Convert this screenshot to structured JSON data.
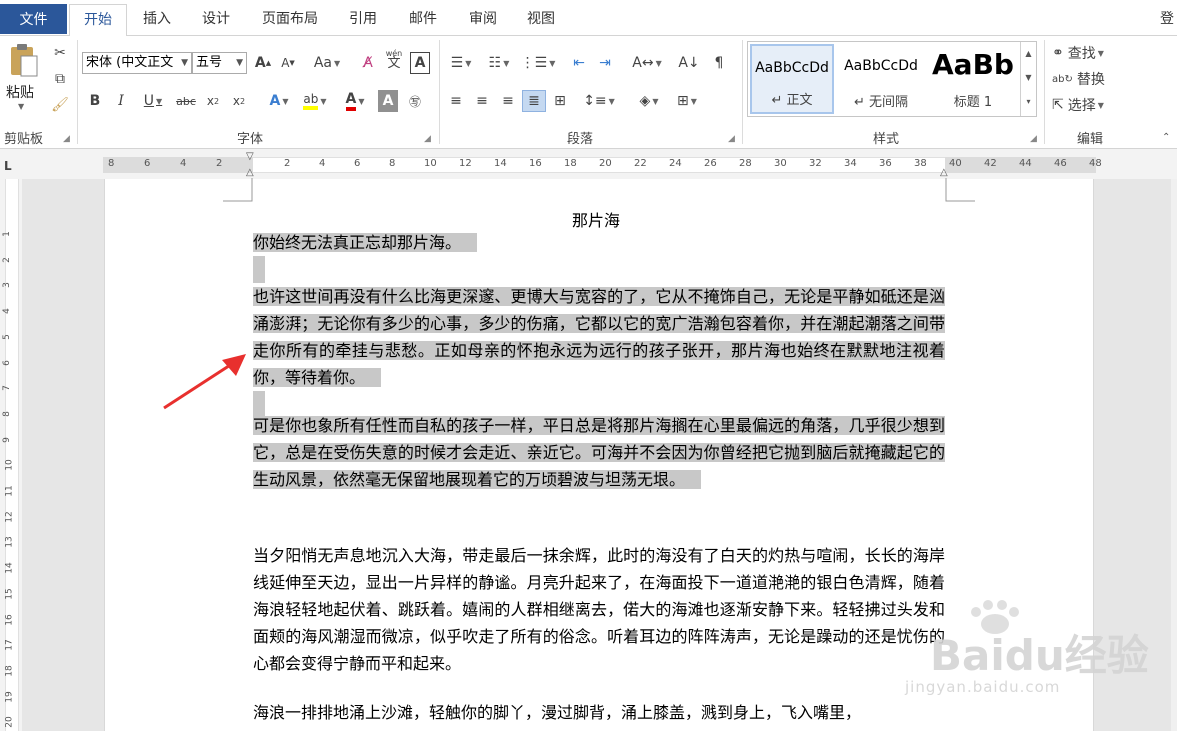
{
  "tabs": {
    "file": "文件",
    "items": [
      "开始",
      "插入",
      "设计",
      "页面布局",
      "引用",
      "邮件",
      "审阅",
      "视图"
    ],
    "login": "登"
  },
  "clipboard": {
    "paste": "粘贴",
    "group": "剪贴板"
  },
  "font": {
    "name": "宋体 (中文正文",
    "size": "五号",
    "group": "字体",
    "change_case": "Aa",
    "phonetic_top": "wén",
    "phonetic_bottom": "文",
    "border_char": "A"
  },
  "paragraph": {
    "group": "段落"
  },
  "styles": {
    "group": "样式",
    "items": [
      {
        "sample": "AaBbCcDd",
        "name": "↵ 正文"
      },
      {
        "sample": "AaBbCcDd",
        "name": "↵ 无间隔"
      },
      {
        "sample": "AaBb",
        "name": "标题 1"
      }
    ]
  },
  "editing": {
    "find": "查找",
    "replace": "替换",
    "select": "选择",
    "group": "编辑"
  },
  "ruler": {
    "corner": "L",
    "left_numbers": [
      "8",
      "6",
      "4",
      "2"
    ],
    "right_numbers": [
      "2",
      "4",
      "6",
      "8",
      "10",
      "12",
      "14",
      "16",
      "18",
      "20",
      "22",
      "24",
      "26",
      "28",
      "30",
      "32",
      "34",
      "36",
      "38",
      "40",
      "42",
      "44",
      "46",
      "48"
    ],
    "vertical_numbers": [
      "1",
      "2",
      "3",
      "4",
      "5",
      "6",
      "7",
      "8",
      "9",
      "10",
      "11",
      "12",
      "13",
      "14",
      "15",
      "16",
      "17",
      "18",
      "19",
      "20"
    ]
  },
  "document": {
    "title": "那片海",
    "p1": "你始终无法真正忘却那片海。",
    "p2": "也许这世间再没有什么比海更深邃、更博大与宽容的了，它从不掩饰自己，无论是平静如砥还是汹涌澎湃；无论你有多少的心事，多少的伤痛，它都以它的宽广浩瀚包容着你，并在潮起潮落之间带走你所有的牵挂与悲愁。正如母亲的怀抱永远为远行的孩子张开，那片海也始终在默默地注视着你，等待着你。",
    "p3": "可是你也象所有任性而自私的孩子一样，平日总是将那片海搁在心里最偏远的角落，几乎很少想到它，总是在受伤失意的时候才会走近、亲近它。可海并不会因为你曾经把它抛到脑后就掩藏起它的生动风景，依然毫无保留地展现着它的万顷碧波与坦荡无垠。",
    "p4": "当夕阳悄无声息地沉入大海，带走最后一抹余辉，此时的海没有了白天的灼热与喧闹，长长的海岸线延伸至天边，显出一片异样的静谧。月亮升起来了，在海面投下一道道滟滟的银白色清辉，随着海浪轻轻地起伏着、跳跃着。嬉闹的人群相继离去，偌大的海滩也逐渐安静下来。轻轻拂过头发和面颊的海风潮湿而微凉，似乎吹走了所有的俗念。听着耳边的阵阵涛声，无论是躁动的还是忧伤的心都会变得宁静而平和起来。",
    "p5": "海浪一排排地涌上沙滩，轻触你的脚丫，漫过脚背，涌上膝盖，溅到身上，飞入嘴里，"
  },
  "watermark": {
    "brand": "Baidu经验",
    "url": "jingyan.baidu.com"
  },
  "colors": {
    "file_tab": "#2b579a",
    "highlight": "#c8c8c8",
    "arrow": "#e8302e"
  }
}
